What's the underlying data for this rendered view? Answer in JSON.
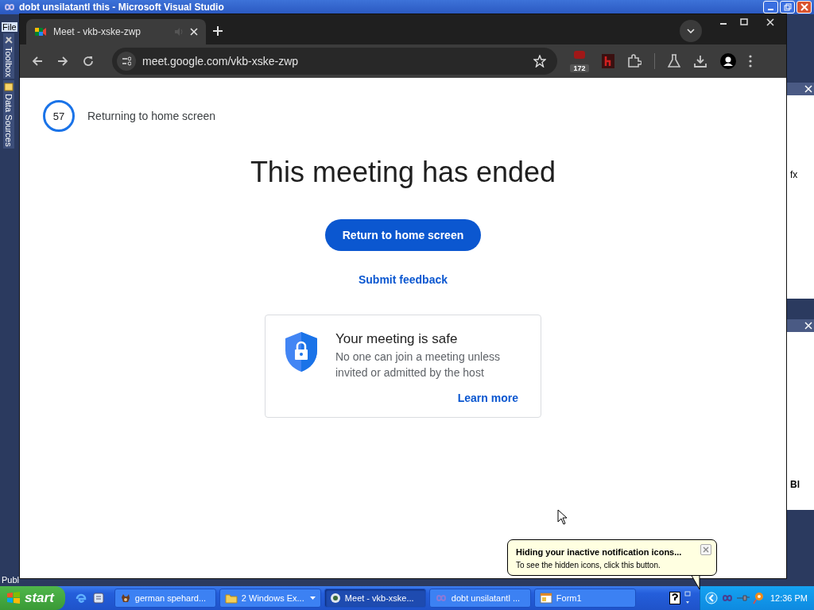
{
  "vs_window": {
    "title": "dobt unsilatantl this - Microsoft Visual Studio",
    "menu": [
      "File"
    ],
    "side_tabs": [
      {
        "label": "Toolbox",
        "kind": "tools"
      },
      {
        "label": "Data Sources",
        "kind": "data"
      }
    ],
    "right_panel_texts": [
      "fx",
      "Bl"
    ],
    "status_text": "Publ"
  },
  "browser": {
    "tabs": [
      {
        "title": "Meet - vkb-xske-zwp",
        "selected": true
      }
    ],
    "address": "meet.google.com/vkb-xske-zwp",
    "extension_badge": "172"
  },
  "page": {
    "countdown": "57",
    "countdown_label": "Returning to home screen",
    "heading": "This meeting has ended",
    "primary_button": "Return to home screen",
    "feedback_link": "Submit feedback",
    "card": {
      "title": "Your meeting is safe",
      "text": "No one can join a meeting unless invited or admitted by the host",
      "link": "Learn more"
    }
  },
  "taskbar": {
    "start": "start",
    "tasks": [
      {
        "label": "german spehard...",
        "kind": "dog",
        "grouped": false,
        "selected": false
      },
      {
        "label": "2 Windows Ex...",
        "kind": "folder",
        "grouped": true,
        "selected": false
      },
      {
        "label": "Meet - vkb-xske...",
        "kind": "browser",
        "grouped": false,
        "selected": true
      },
      {
        "label": "dobt unsilatantl ...",
        "kind": "studio",
        "grouped": false,
        "selected": false
      },
      {
        "label": "Form1",
        "kind": "form",
        "grouped": false,
        "selected": false
      }
    ],
    "clock": "12:36 PM"
  },
  "balloon": {
    "title": "Hiding your inactive notification icons...",
    "text": "To see the hidden icons, click this button."
  }
}
